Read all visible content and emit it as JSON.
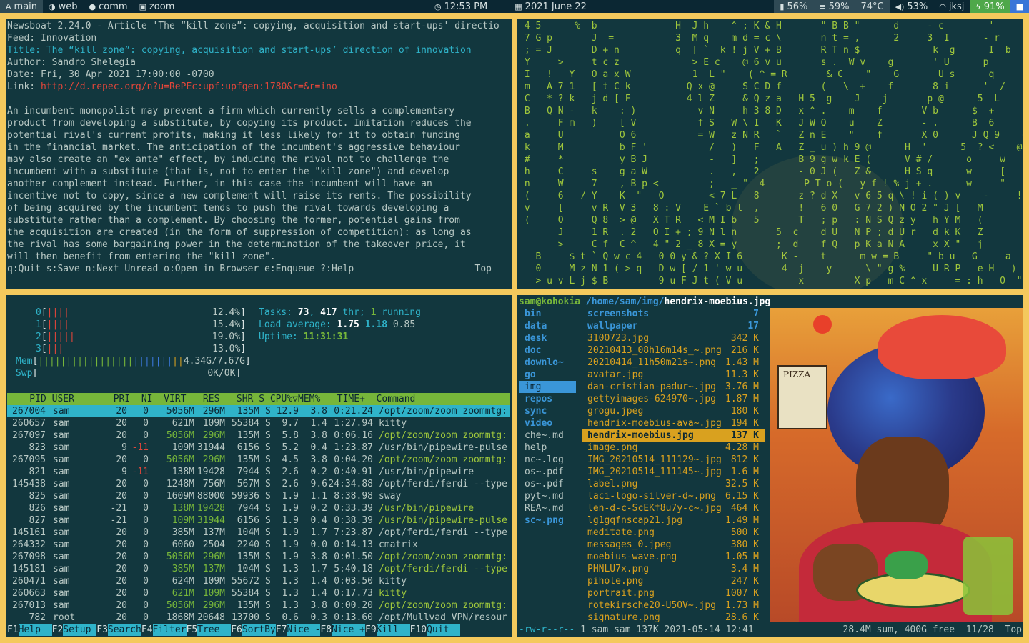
{
  "topbar": {
    "workspaces": [
      {
        "icon": "A",
        "label": "main",
        "active": true
      },
      {
        "icon": "◑",
        "label": "web",
        "active": false
      },
      {
        "icon": "●",
        "label": "comm",
        "active": false
      },
      {
        "icon": "▣",
        "label": "zoom",
        "active": false
      }
    ],
    "time": "12:53 PM",
    "date": "2021 June 22",
    "battery": "56%",
    "memory": "59%",
    "temp": "74°C",
    "volume": "53%",
    "user": "jksj",
    "power": "91%"
  },
  "newsboat": {
    "lines": [
      "Newsboat 2.24.0 - Article 'The “kill zone”: copying, acquisition and start-ups' directio",
      "Feed: Innovation"
    ],
    "title": "Title: The “kill zone”: copying, acquisition and start-ups’ direction of innovation",
    "author": "Author: Sandro Shelegia",
    "date": "Date: Fri, 30 Apr 2021 17:00:00 -0700",
    "link_label": "Link: ",
    "link_url": "http://d.repec.org/n?u=RePEc:upf:upfgen:1780&r=&r=ino",
    "body": [
      "An incumbent monopolist may prevent a firm which currently sells a complementary",
      "product from developing a substitute, by copying its product. Imitation reduces the",
      "potential rival's current profits, making it less likely for it to obtain funding",
      "in the financial market. The anticipation of the incumbent's aggressive behaviour",
      "may also create an \"ex ante\" effect, by inducing the rival not to challenge the",
      "incumbent with a substitute (that is, not to enter the \"kill zone\") and develop",
      "another complement instead. Further, in this case the incumbent will have an",
      "incentive not to copy, since a new complement will raise its rents. The possibility",
      "of being acquired by the incumbent tends to push the rival towards developing a",
      "substitute rather than a complement. By choosing the former, potential gains from",
      "the acquisition are created (in the form of suppression of competition): as long as",
      "the rival has some bargaining power in the determination of the takeover price, it",
      "will then benefit from entering the \"kill zone\"."
    ],
    "footer_keys": "q:Quit s:Save n:Next Unread o:Open in Browser e:Enqueue ?:Help",
    "footer_pos": "Top"
  },
  "matrix": {
    "lines": [
      " 4 5      %  b              H  J h    ^ ; K & H       \" B B \"      d     - c        '      l",
      " 7 G p       J  =           3  M q    m d = c \\       n t = ,      2     3  I      - r      O",
      " ; = J       D + n          q  [ `  k ! j V + B       R T n $             k  g      I  b     A",
      " Y     >     t c z             > E c    @ 6 v u       s .  W v    g       ' U      p       A",
      " I   !   Y   O a x W           1  L \"    ( ^ = R       & C    \"    G       U s      q       `",
      " m   A 7 1   [ t C k          Q x @     S C D f       (   \\  +    f       8 i      '  /     L",
      " C   * ? k   j d [ F          4 l Z     & Q z a   H 5  g    J    j       p @      5  L     d",
      " B   Q N -   k    : )           v N     h 3 8 D   x ^ .    m    f       V b      $  +     K",
      " .     F m   )    [ V           f S   W \\ I   K   J W Q    u    Z       - .      B  6     V",
      " a     U          O 6           = W   z N R   `   Z n E    \"    f       X 0      J Q 9    +",
      " k     M          b F '           /   )   F   A   Z _ u ) h 9 @      H  '      5  ? <    @",
      " #     *          y B J           -   ]   ;       B 9 g w k E (      V # /      o     w    o",
      " h     C     s    g a W           .   ,   2       - 0 J (   Z &      H S q      w     [    m",
      " n     W     7    , B p <         ;   _ \"  4       P T o (   y f ! % j + .      w     \"    !",
      " (     6   / Y    K  \"   O        < 7 L   8       z ? d X   v 6 5 q \\ ! i ( ) v    -     !",
      " v     [     v R  V 3   8 : V    E ` b l  ,       !   6 0   G 7 2 ) N O 2 \" J [   M",
      " (     O     Q 8  > @   X T R   < M I b   5       T   ; p   : N S Q z y   h Y M   (",
      "       J     1 R  . 2   O I + ; 9 N l n       5  c    d U   N P ; d U r   d k K   Z",
      "       >     C f  C ^   4 \" 2 _ 8 X = y       ;  d    f Q   p K a N A     x X \"   j",
      "   B     $ t ` Q w c 4   0 0 y & ? X I 6       K -    t      m w = B     \" b u   G     a",
      "   0     M z N 1 ( > q   D w [ / 1 ' w u       4  j    y      \\ \" g %     U R P   e H   )",
      "   > u v L j $ B         9 u F J t ( V u          x         X p   m C ^ x     = : h   O  \" u"
    ]
  },
  "htop": {
    "cpus": [
      {
        "label": "0",
        "bars_red": "||||",
        "bars_green": "",
        "value": "12.4%"
      },
      {
        "label": "1",
        "bars_red": "||||",
        "bars_green": "",
        "value": "15.4%"
      },
      {
        "label": "2",
        "bars_red": "|||||",
        "bars_green": "",
        "value": "19.0%"
      },
      {
        "label": "3",
        "bars_red": "|||",
        "bars_green": "",
        "value": "13.0%"
      }
    ],
    "mem": {
      "label": "Mem",
      "bars_green": "|||||||||||||||||",
      "bars_blue": "|||||||",
      "bars_yellow": "||",
      "value": "4.34G/7.67G"
    },
    "swp": {
      "label": "Swp",
      "value": "0K/0K"
    },
    "tasks_label": "Tasks: ",
    "tasks": "73",
    "thr_sep": ", ",
    "thr": "417",
    "thr_label": " thr; ",
    "running": "1",
    "running_label": " running",
    "load_label": "Load average: ",
    "load1": "1.75",
    "load5": "1.18",
    "load15": "0.85",
    "uptime_label": "Uptime: ",
    "uptime": "11:31:31",
    "header": "    PID USER       PRI  NI  VIRT   RES   SHR S CPU%▽MEM%   TIME+  Command",
    "processes": [
      {
        "pid": "267004",
        "user": "sam",
        "pri": "20",
        "ni": "0",
        "virt": "5056M",
        "res": "296M",
        "shr": "135M",
        "s": "S",
        "cpu": "12.9",
        "mem": "3.8",
        "time": "0:21.24",
        "cmd": "/opt/zoom/zoom zoommtg:",
        "green": false
      },
      {
        "pid": "260657",
        "user": "sam",
        "pri": "20",
        "ni": "0",
        "virt": "621M",
        "res": "109M",
        "shr": "55384",
        "s": "S",
        "cpu": "9.7",
        "mem": "1.4",
        "time": "1:27.94",
        "cmd": "kitty",
        "green": false
      },
      {
        "pid": "267097",
        "user": "sam",
        "pri": "20",
        "ni": "0",
        "virt": "5056M",
        "res": "296M",
        "shr": "135M",
        "s": "S",
        "cpu": "5.8",
        "mem": "3.8",
        "time": "0:06.16",
        "cmd": "/opt/zoom/zoom zoommtg:",
        "green": true
      },
      {
        "pid": "823",
        "user": "sam",
        "pri": "9",
        "ni": "-11",
        "virt": "109M",
        "res": "31944",
        "shr": "6156",
        "s": "S",
        "cpu": "5.2",
        "mem": "0.4",
        "time": "1:23.87",
        "cmd": "/usr/bin/pipewire-pulse",
        "green": false
      },
      {
        "pid": "267095",
        "user": "sam",
        "pri": "20",
        "ni": "0",
        "virt": "5056M",
        "res": "296M",
        "shr": "135M",
        "s": "S",
        "cpu": "4.5",
        "mem": "3.8",
        "time": "0:04.20",
        "cmd": "/opt/zoom/zoom zoommtg:",
        "green": true
      },
      {
        "pid": "821",
        "user": "sam",
        "pri": "9",
        "ni": "-11",
        "virt": "138M",
        "res": "19428",
        "shr": "7944",
        "s": "S",
        "cpu": "2.6",
        "mem": "0.2",
        "time": "0:40.91",
        "cmd": "/usr/bin/pipewire",
        "green": false
      },
      {
        "pid": "145438",
        "user": "sam",
        "pri": "20",
        "ni": "0",
        "virt": "1248M",
        "res": "756M",
        "shr": "567M",
        "s": "S",
        "cpu": "2.6",
        "mem": "9.6",
        "time": "24:34.88",
        "cmd": "/opt/ferdi/ferdi --type",
        "green": false
      },
      {
        "pid": "825",
        "user": "sam",
        "pri": "20",
        "ni": "0",
        "virt": "1609M",
        "res": "88000",
        "shr": "59936",
        "s": "S",
        "cpu": "1.9",
        "mem": "1.1",
        "time": "8:38.98",
        "cmd": "sway",
        "green": false
      },
      {
        "pid": "826",
        "user": "sam",
        "pri": "-21",
        "ni": "0",
        "virt": "138M",
        "res": "19428",
        "shr": "7944",
        "s": "S",
        "cpu": "1.9",
        "mem": "0.2",
        "time": "0:33.39",
        "cmd": "/usr/bin/pipewire",
        "green": true
      },
      {
        "pid": "827",
        "user": "sam",
        "pri": "-21",
        "ni": "0",
        "virt": "109M",
        "res": "31944",
        "shr": "6156",
        "s": "S",
        "cpu": "1.9",
        "mem": "0.4",
        "time": "0:38.39",
        "cmd": "/usr/bin/pipewire-pulse",
        "green": true
      },
      {
        "pid": "145161",
        "user": "sam",
        "pri": "20",
        "ni": "0",
        "virt": "385M",
        "res": "137M",
        "shr": "104M",
        "s": "S",
        "cpu": "1.9",
        "mem": "1.7",
        "time": "7:23.87",
        "cmd": "/opt/ferdi/ferdi --type",
        "green": false
      },
      {
        "pid": "264332",
        "user": "sam",
        "pri": "20",
        "ni": "0",
        "virt": "6060",
        "res": "2504",
        "shr": "2240",
        "s": "S",
        "cpu": "1.9",
        "mem": "0.0",
        "time": "0:14.13",
        "cmd": "cmatrix",
        "green": false
      },
      {
        "pid": "267098",
        "user": "sam",
        "pri": "20",
        "ni": "0",
        "virt": "5056M",
        "res": "296M",
        "shr": "135M",
        "s": "S",
        "cpu": "1.9",
        "mem": "3.8",
        "time": "0:01.50",
        "cmd": "/opt/zoom/zoom zoommtg:",
        "green": true
      },
      {
        "pid": "145181",
        "user": "sam",
        "pri": "20",
        "ni": "0",
        "virt": "385M",
        "res": "137M",
        "shr": "104M",
        "s": "S",
        "cpu": "1.3",
        "mem": "1.7",
        "time": "5:40.18",
        "cmd": "/opt/ferdi/ferdi --type",
        "green": true
      },
      {
        "pid": "260471",
        "user": "sam",
        "pri": "20",
        "ni": "0",
        "virt": "624M",
        "res": "109M",
        "shr": "55672",
        "s": "S",
        "cpu": "1.3",
        "mem": "1.4",
        "time": "0:03.50",
        "cmd": "kitty",
        "green": false
      },
      {
        "pid": "260663",
        "user": "sam",
        "pri": "20",
        "ni": "0",
        "virt": "621M",
        "res": "109M",
        "shr": "55384",
        "s": "S",
        "cpu": "1.3",
        "mem": "1.4",
        "time": "0:17.73",
        "cmd": "kitty",
        "green": true
      },
      {
        "pid": "267013",
        "user": "sam",
        "pri": "20",
        "ni": "0",
        "virt": "5056M",
        "res": "296M",
        "shr": "135M",
        "s": "S",
        "cpu": "1.3",
        "mem": "3.8",
        "time": "0:00.20",
        "cmd": "/opt/zoom/zoom zoommtg:",
        "green": true
      },
      {
        "pid": "782",
        "user": "root",
        "pri": "20",
        "ni": "0",
        "virt": "1868M",
        "res": "20648",
        "shr": "13700",
        "s": "S",
        "cpu": "0.6",
        "mem": "0.3",
        "time": "0:13.60",
        "cmd": "/opt/Mullvad VPN/resour",
        "green": false
      }
    ],
    "footer": [
      {
        "key": "F1",
        "label": "Help  "
      },
      {
        "key": "F2",
        "label": "Setup "
      },
      {
        "key": "F3",
        "label": "Search"
      },
      {
        "key": "F4",
        "label": "Filter"
      },
      {
        "key": "F5",
        "label": "Tree  "
      },
      {
        "key": "F6",
        "label": "SortBy"
      },
      {
        "key": "F7",
        "label": "Nice -"
      },
      {
        "key": "F8",
        "label": "Nice +"
      },
      {
        "key": "F9",
        "label": "Kill  "
      },
      {
        "key": "F10",
        "label": "Quit  "
      }
    ]
  },
  "ranger": {
    "host": "sam@kohokia",
    "path": " /home/sam/img/",
    "file": "hendrix-moebius.jpg",
    "left": [
      {
        "name": "bin",
        "type": "dir"
      },
      {
        "name": "data",
        "type": "dir"
      },
      {
        "name": "desk",
        "type": "dir"
      },
      {
        "name": "doc",
        "type": "dir"
      },
      {
        "name": "downlo~",
        "type": "dir"
      },
      {
        "name": "go",
        "type": "dir"
      },
      {
        "name": "img",
        "type": "sel-dir"
      },
      {
        "name": "repos",
        "type": "dir"
      },
      {
        "name": "sync",
        "type": "dir"
      },
      {
        "name": "video",
        "type": "dir"
      },
      {
        "name": "che~.md",
        "type": "file"
      },
      {
        "name": "help",
        "type": "file"
      },
      {
        "name": "nc~.log",
        "type": "file"
      },
      {
        "name": "os~.pdf",
        "type": "file"
      },
      {
        "name": "os~.pdf",
        "type": "file"
      },
      {
        "name": "pyt~.md",
        "type": "file"
      },
      {
        "name": "REA~.md",
        "type": "file"
      },
      {
        "name": "sc~.png",
        "type": "dir"
      }
    ],
    "files": [
      {
        "name": "screenshots",
        "size": "7",
        "type": "dir"
      },
      {
        "name": "wallpaper",
        "size": "17",
        "type": "dir"
      },
      {
        "name": "3100723.jpg",
        "size": "342 K",
        "type": "img"
      },
      {
        "name": "20210413_08h16m14s_~.png",
        "size": "216 K",
        "type": "img"
      },
      {
        "name": "20210414_11h50m21s~.png",
        "size": "1.43 M",
        "type": "img"
      },
      {
        "name": "avatar.jpg",
        "size": "11.3 K",
        "type": "img"
      },
      {
        "name": "dan-cristian-padur~.jpg",
        "size": "3.76 M",
        "type": "img"
      },
      {
        "name": "gettyimages-624970~.jpg",
        "size": "1.87 M",
        "type": "img"
      },
      {
        "name": "grogu.jpeg",
        "size": "180 K",
        "type": "img"
      },
      {
        "name": "hendrix-moebius-ava~.jpg",
        "size": "194 K",
        "type": "img"
      },
      {
        "name": "hendrix-moebius.jpg",
        "size": "137 K",
        "type": "sel-file"
      },
      {
        "name": "image.png",
        "size": "4.28 M",
        "type": "img"
      },
      {
        "name": "IMG_20210514_111129~.jpg",
        "size": "812 K",
        "type": "img"
      },
      {
        "name": "IMG_20210514_111145~.jpg",
        "size": "1.6 M",
        "type": "img"
      },
      {
        "name": "label.png",
        "size": "32.5 K",
        "type": "img"
      },
      {
        "name": "laci-logo-silver-d~.png",
        "size": "6.15 K",
        "type": "img"
      },
      {
        "name": "len-d-c-ScEKf8u7y-c~.jpg",
        "size": "464 K",
        "type": "img"
      },
      {
        "name": "lg1gqfnscap21.jpg",
        "size": "1.49 M",
        "type": "img"
      },
      {
        "name": "meditate.png",
        "size": "500 K",
        "type": "img"
      },
      {
        "name": "messages_0.jpeg",
        "size": "380 K",
        "type": "img"
      },
      {
        "name": "moebius-wave.png",
        "size": "1.05 M",
        "type": "img"
      },
      {
        "name": "PHNLU7x.png",
        "size": "3.4 M",
        "type": "img"
      },
      {
        "name": "pihole.png",
        "size": "247 K",
        "type": "img"
      },
      {
        "name": "portrait.png",
        "size": "1007 K",
        "type": "img"
      },
      {
        "name": "rotekirsche20-U5OV~.jpg",
        "size": "1.73 M",
        "type": "img"
      },
      {
        "name": "signature.png",
        "size": "28.6 K",
        "type": "img"
      }
    ],
    "footer_perm": "-rw-r--r--",
    "footer_info": " 1 sam sam 137K 2021-05-14 12:41",
    "footer_right": "28.4M sum, 400G free  11/28  Top",
    "preview_sign": "PIZZA"
  }
}
